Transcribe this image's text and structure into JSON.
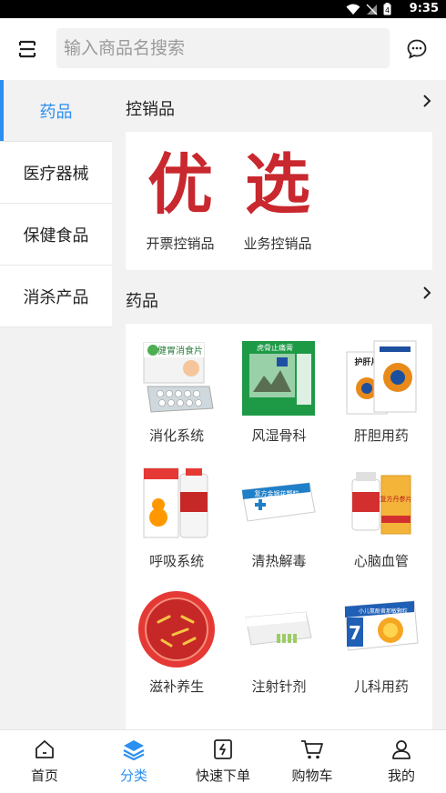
{
  "status_bar": {
    "time": "9:35"
  },
  "search": {
    "placeholder": "输入商品名搜索"
  },
  "sidebar": {
    "items": [
      {
        "label": "药品",
        "active": true
      },
      {
        "label": "医疗器械",
        "active": false
      },
      {
        "label": "保健食品",
        "active": false
      },
      {
        "label": "消杀产品",
        "active": false
      }
    ]
  },
  "sections": {
    "controlled": {
      "title": "控销品",
      "items": [
        {
          "label": "开票控销品",
          "banner": "优"
        },
        {
          "label": "业务控销品",
          "banner": "选"
        }
      ]
    },
    "drugs": {
      "title": "药品",
      "items": [
        {
          "label": "消化系统",
          "pack_text": "健胃消食片"
        },
        {
          "label": "风湿骨科",
          "pack_text": "虎骨止痛膏"
        },
        {
          "label": "肝胆用药",
          "pack_text": "护肝片"
        },
        {
          "label": "呼吸系统",
          "pack_text": ""
        },
        {
          "label": "清热解毒",
          "pack_text": "复方金银花颗粒"
        },
        {
          "label": "心脑血管",
          "pack_text": "复方丹参片"
        },
        {
          "label": "滋补养生",
          "pack_text": ""
        },
        {
          "label": "注射针剂",
          "pack_text": ""
        },
        {
          "label": "儿科用药",
          "pack_text": "小儿氨酚黄那敏颗粒"
        }
      ]
    }
  },
  "bottom_nav": {
    "items": [
      {
        "label": "首页",
        "icon": "home-icon"
      },
      {
        "label": "分类",
        "icon": "layers-icon",
        "active": true
      },
      {
        "label": "快速下单",
        "icon": "quick-order-icon"
      },
      {
        "label": "购物车",
        "icon": "cart-icon"
      },
      {
        "label": "我的",
        "icon": "user-icon"
      }
    ]
  },
  "colors": {
    "accent": "#2b8ff0",
    "banner_red": "#c8282e"
  }
}
